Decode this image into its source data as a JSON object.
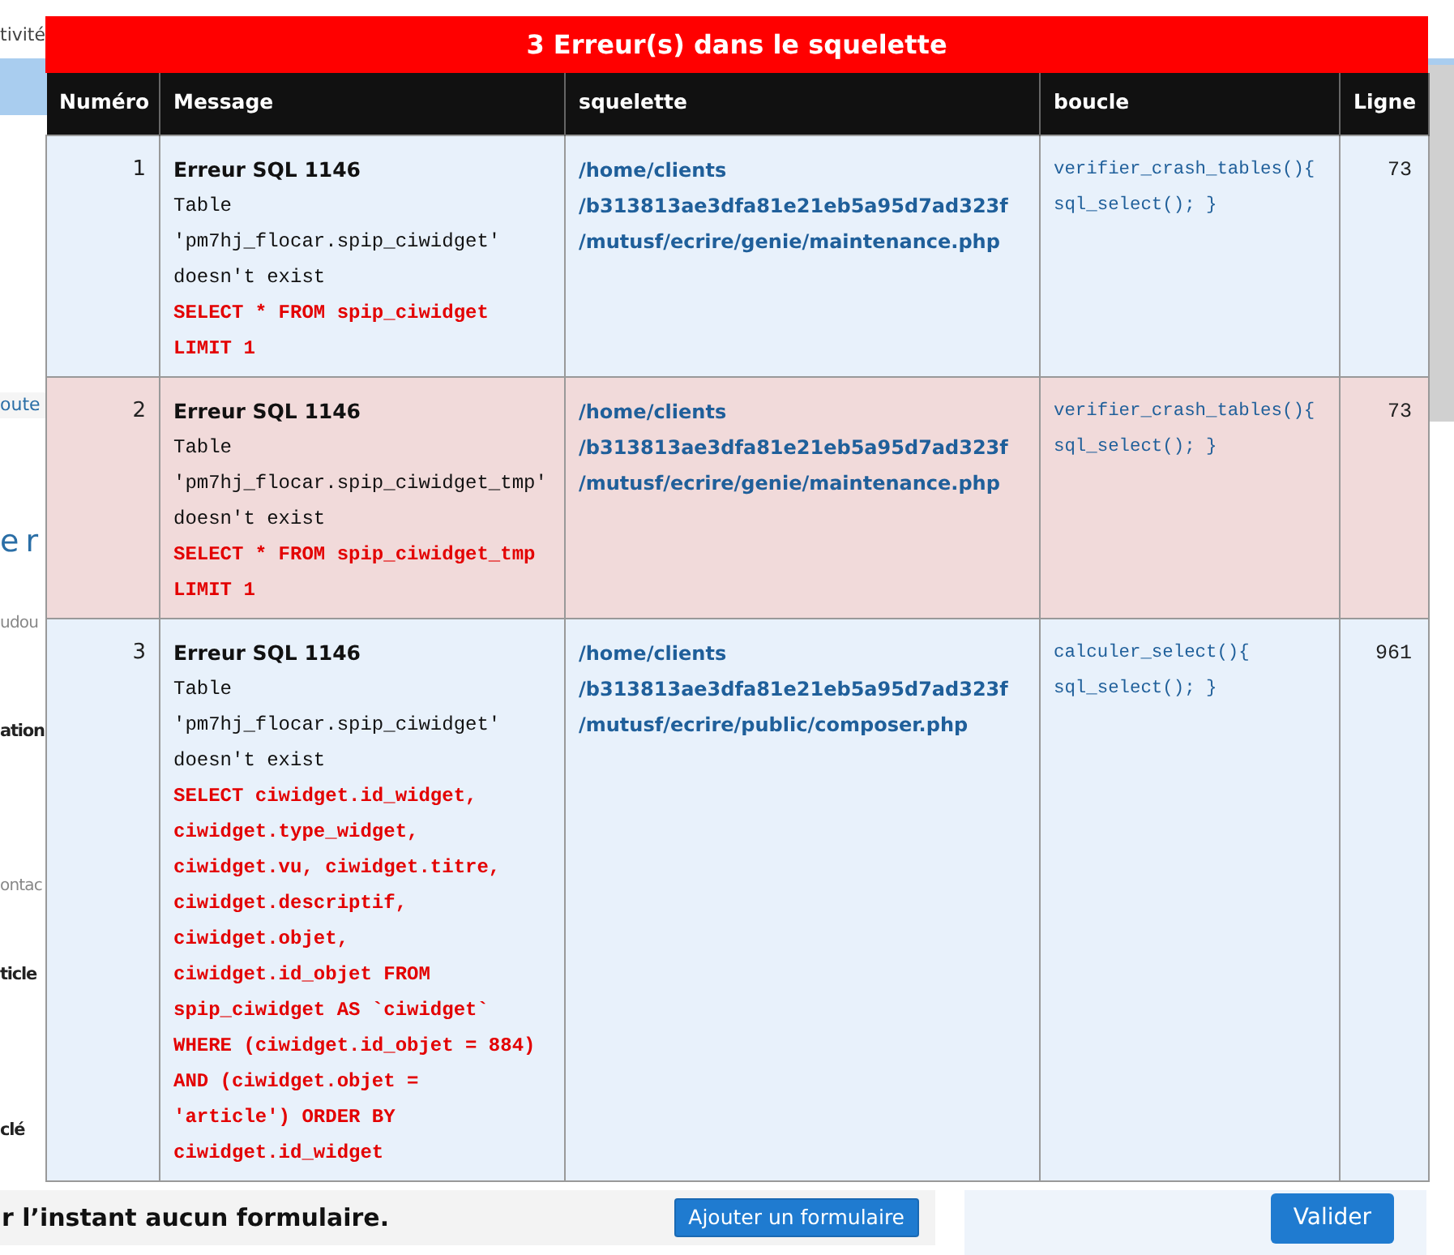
{
  "background": {
    "strip": [
      {
        "kind": "plain",
        "text": "tivité"
      },
      {
        "kind": "link",
        "text": "oute"
      },
      {
        "kind": "title",
        "text": "e r"
      },
      {
        "kind": "muted",
        "text": "udou"
      },
      {
        "kind": "bold",
        "text": "ation"
      },
      {
        "kind": "muted",
        "text": "ontac"
      },
      {
        "kind": "bold",
        "text": "ticle"
      },
      {
        "kind": "bold",
        "text": "clé"
      }
    ],
    "form_note": "r l’instant aucun formulaire.",
    "add_form_button": "Ajouter un formulaire",
    "submit_button": "Valider"
  },
  "debug": {
    "title": "3 Erreur(s) dans le squelette",
    "columns": [
      "Numéro",
      "Message",
      "squelette",
      "boucle",
      "Ligne"
    ],
    "errors": [
      {
        "number": "1",
        "error_title": "Erreur SQL 1146",
        "message_lines": [
          "Table",
          "'pm7hj_flocar.spip_ciwidget'",
          "doesn't exist"
        ],
        "query_lines": [
          "SELECT * FROM spip_ciwidget",
          "LIMIT 1"
        ],
        "path_lines": [
          "/home/clients",
          "/b313813ae3dfa81e21eb5a95d7ad323f",
          "/mutusf/ecrire/genie/maintenance.php"
        ],
        "loop_lines": [
          "verifier_crash_tables(){",
          "sql_select(); }"
        ],
        "line": "73",
        "highlighted": false
      },
      {
        "number": "2",
        "error_title": "Erreur SQL 1146",
        "message_lines": [
          "Table",
          "'pm7hj_flocar.spip_ciwidget_tmp'",
          "doesn't exist"
        ],
        "query_lines": [
          "SELECT * FROM spip_ciwidget_tmp",
          "LIMIT 1"
        ],
        "path_lines": [
          "/home/clients",
          "/b313813ae3dfa81e21eb5a95d7ad323f",
          "/mutusf/ecrire/genie/maintenance.php"
        ],
        "loop_lines": [
          "verifier_crash_tables(){",
          "sql_select(); }"
        ],
        "line": "73",
        "highlighted": true
      },
      {
        "number": "3",
        "error_title": "Erreur SQL 1146",
        "message_lines": [
          "Table",
          "'pm7hj_flocar.spip_ciwidget'",
          "doesn't exist"
        ],
        "query_lines": [
          "SELECT ciwidget.id_widget,",
          "ciwidget.type_widget,",
          "ciwidget.vu, ciwidget.titre,",
          "ciwidget.descriptif,",
          "ciwidget.objet,",
          "ciwidget.id_objet FROM",
          "spip_ciwidget AS `ciwidget`",
          "WHERE (ciwidget.id_objet = 884)",
          "AND (ciwidget.objet =",
          "'article') ORDER BY",
          "ciwidget.id_widget"
        ],
        "path_lines": [
          "/home/clients",
          "/b313813ae3dfa81e21eb5a95d7ad323f",
          "/mutusf/ecrire/public/composer.php"
        ],
        "loop_lines": [
          "calculer_select(){",
          "sql_select(); }"
        ],
        "line": "961",
        "highlighted": false
      }
    ]
  }
}
